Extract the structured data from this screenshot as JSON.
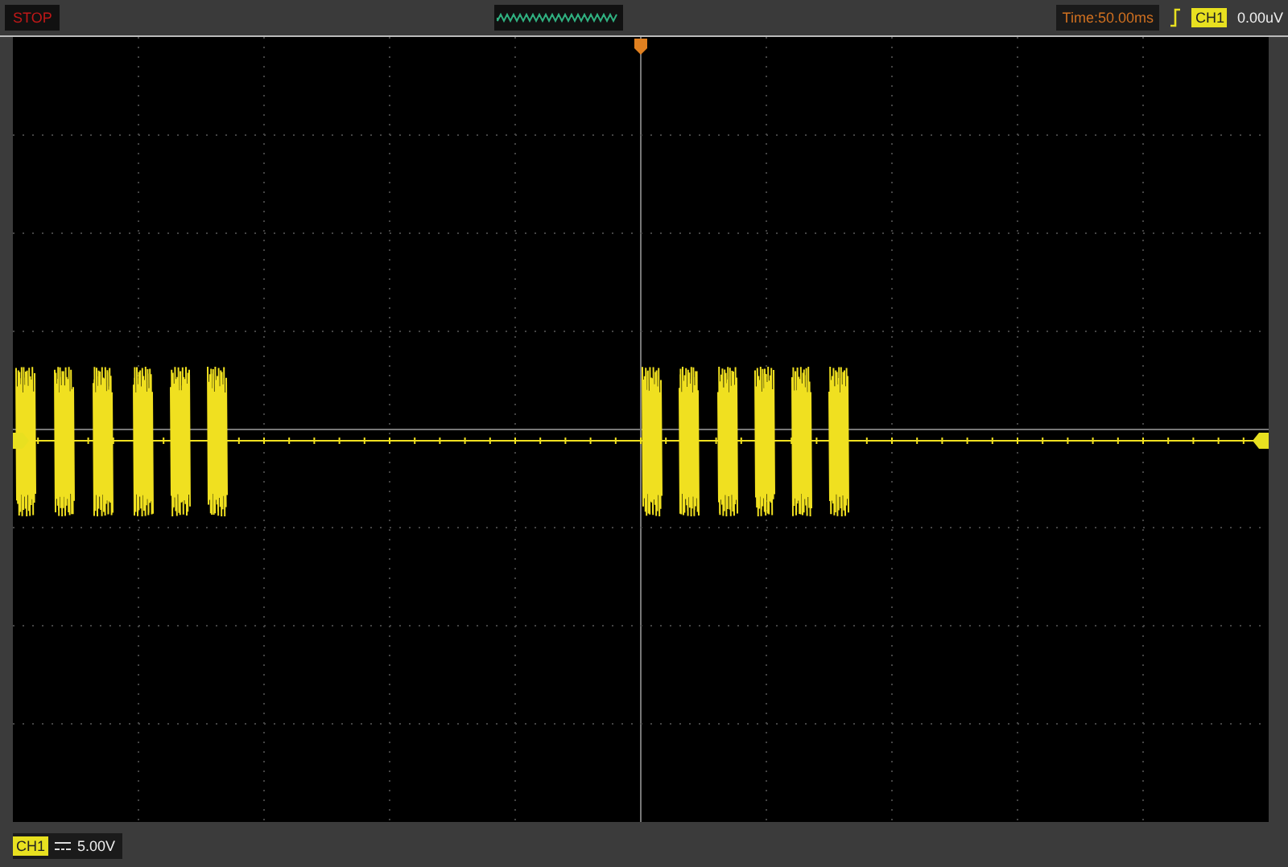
{
  "top_bar": {
    "status": "STOP",
    "timebase": "Time:50.00ms",
    "trigger_channel": "CH1",
    "trigger_level": "0.00uV"
  },
  "bottom_bar": {
    "channel": "CH1",
    "scale": "5.00V"
  }
}
